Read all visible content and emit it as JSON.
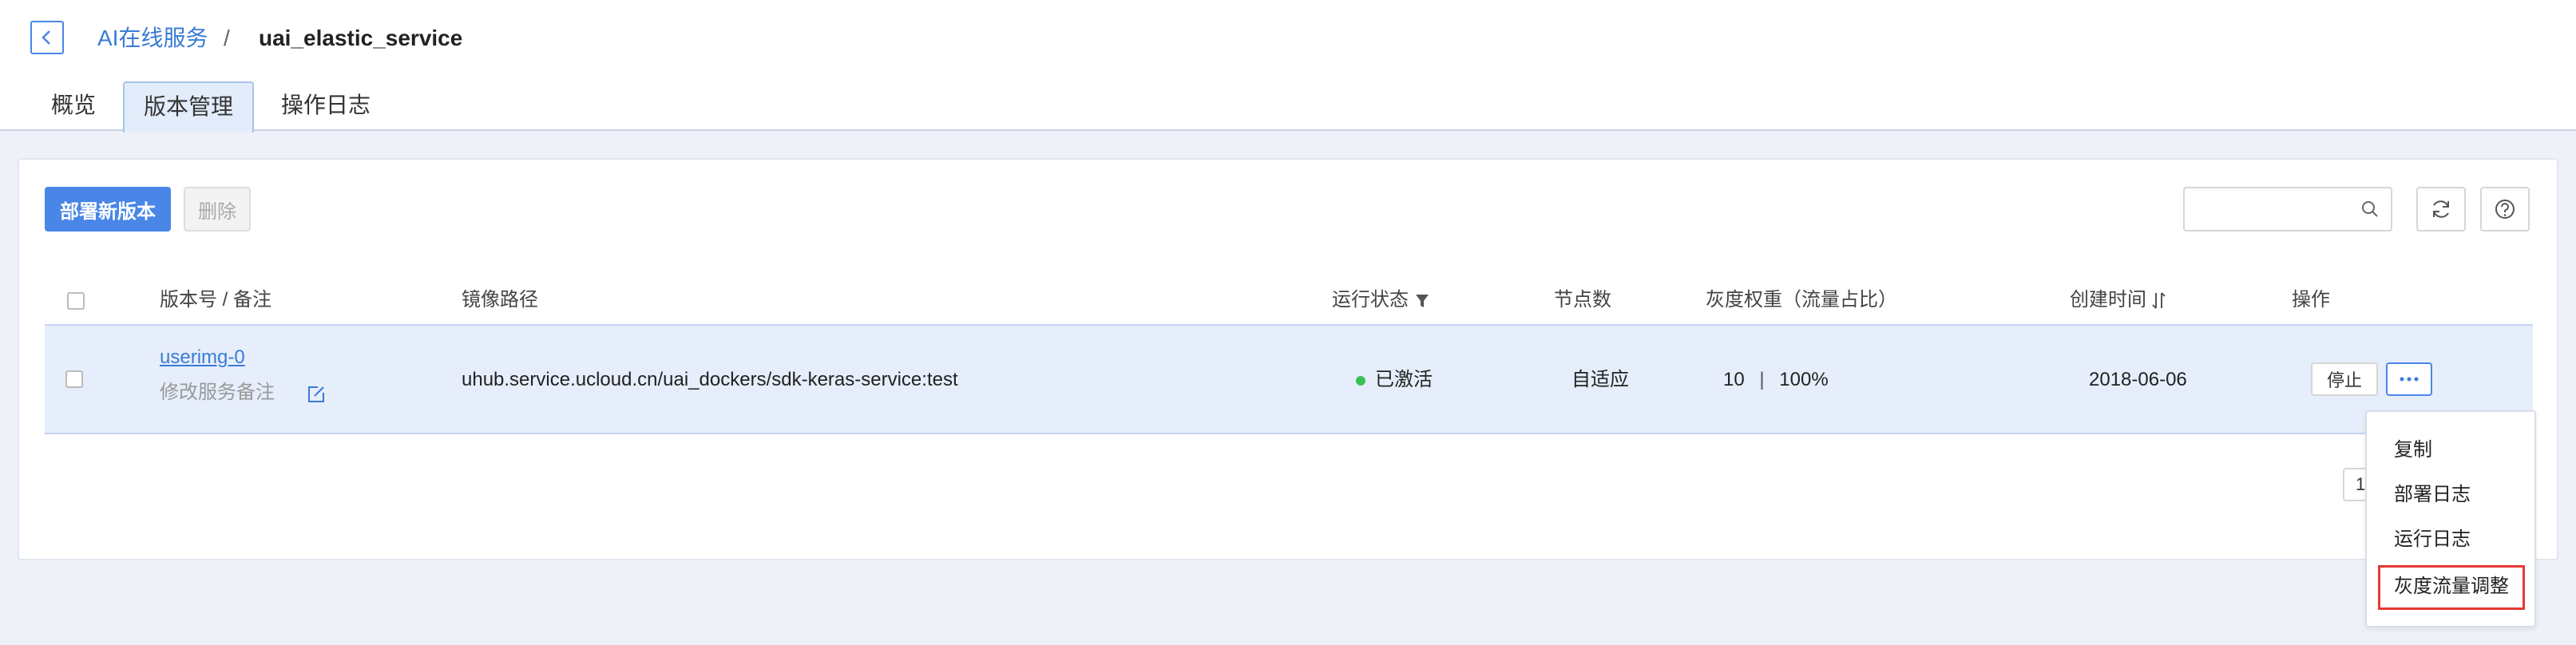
{
  "breadcrumb": {
    "parent": "AI在线服务",
    "separator": "/",
    "current": "uai_elastic_service"
  },
  "tabs": [
    {
      "label": "概览",
      "active": false
    },
    {
      "label": "版本管理",
      "active": true
    },
    {
      "label": "操作日志",
      "active": false
    }
  ],
  "toolbar": {
    "deploy_label": "部署新版本",
    "delete_label": "删除",
    "search_placeholder": ""
  },
  "table": {
    "headers": {
      "version": "版本号 / 备注",
      "image_path": "镜像路径",
      "status": "运行状态",
      "nodes": "节点数",
      "gray_weight": "灰度权重（流量占比）",
      "created": "创建时间",
      "actions": "操作"
    },
    "rows": [
      {
        "version": "userimg-0",
        "remark": "修改服务备注",
        "image_path": "uhub.service.ucloud.cn/uai_dockers/sdk-keras-service:test",
        "status": "已激活",
        "status_color": "#3cbf54",
        "nodes": "自适应",
        "weight": "10",
        "weight_sep": "|",
        "percent": "100%",
        "created": "2018-06-06",
        "stop_label": "停止"
      }
    ]
  },
  "pager": {
    "page_size": "10"
  },
  "dropdown": {
    "items": [
      "复制",
      "部署日志",
      "运行日志",
      "灰度流量调整"
    ],
    "highlighted_index": 3
  },
  "colors": {
    "accent": "#4a86e8",
    "link": "#3a7bd5",
    "highlight_border": "#e53935"
  }
}
